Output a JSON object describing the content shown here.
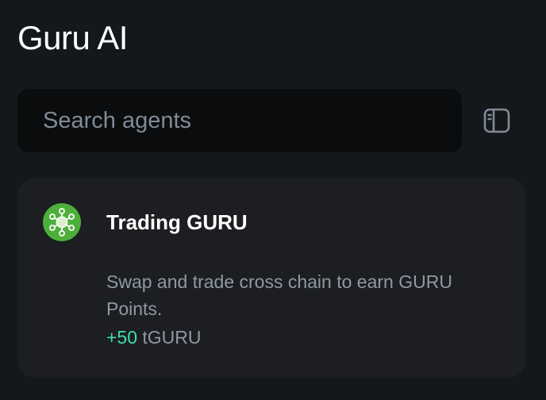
{
  "header": {
    "title": "Guru AI"
  },
  "search": {
    "placeholder": "Search agents",
    "value": ""
  },
  "toolbar": {
    "sidebar_toggle_icon": "sidebar-panel-icon"
  },
  "agents": [
    {
      "name": "Trading GURU",
      "icon": "network-nodes-icon",
      "icon_color": "#4caf3a",
      "description": "Swap and trade cross chain to earn GURU Points.",
      "reward_amount": "+50",
      "reward_unit": "tGURU"
    }
  ],
  "colors": {
    "background": "#15181b",
    "card": "#1c1e21",
    "search_bg": "#0b0c0d",
    "accent_reward": "#3ee0a8",
    "muted_text": "#8e99a5"
  }
}
